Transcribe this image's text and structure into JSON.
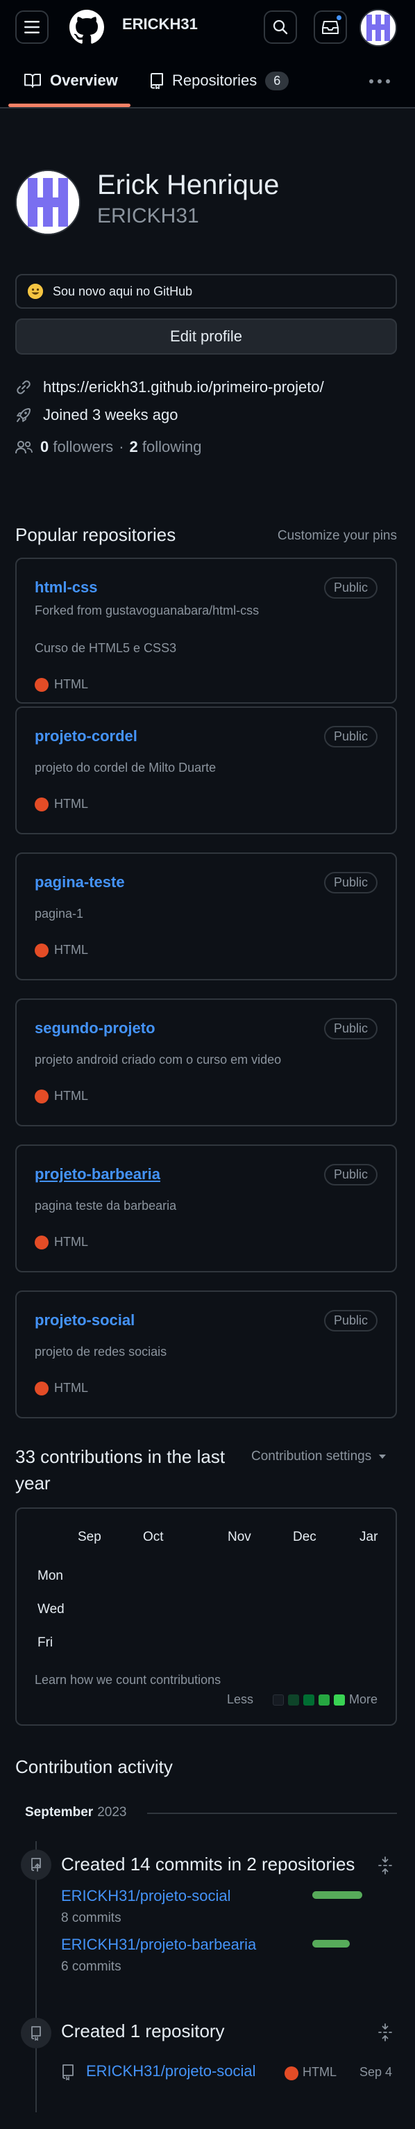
{
  "header": {
    "username": "ERICKH31",
    "icons": [
      "hamburger-menu-icon",
      "github-logo-icon",
      "search-icon",
      "inbox-icon",
      "avatar"
    ]
  },
  "tabs": [
    {
      "label": "Overview",
      "icon": "book-icon",
      "active": true
    },
    {
      "label": "Repositories",
      "icon": "repo-icon",
      "count": "6",
      "active": false
    }
  ],
  "profile": {
    "name": "Erick Henrique",
    "login": "ERICKH31",
    "status": "Sou novo aqui no GitHub",
    "edit_label": "Edit profile",
    "website": "https://erickh31.github.io/primeiro-projeto/",
    "joined": "Joined 3 weeks ago",
    "followers_count": "0",
    "followers_label": "followers",
    "separator": "·",
    "following_count": "2",
    "following_label": "following"
  },
  "popular": {
    "title": "Popular repositories",
    "customize_label": "Customize your pins",
    "repos": [
      {
        "name": "html-css",
        "visibility": "Public",
        "forked_from": "Forked from gustavoguanabara/html-css",
        "description": "Curso de HTML5 e CSS3",
        "language": "HTML"
      },
      {
        "name": "projeto-cordel",
        "visibility": "Public",
        "description": "projeto do cordel de Milto Duarte",
        "language": "HTML"
      },
      {
        "name": "pagina-teste",
        "visibility": "Public",
        "description": "pagina-1",
        "language": "HTML"
      },
      {
        "name": "segundo-projeto",
        "visibility": "Public",
        "description": "projeto android criado com o curso em video",
        "language": "HTML"
      },
      {
        "name": "projeto-barbearia",
        "visibility": "Public",
        "description": "pagina teste da barbearia",
        "language": "HTML"
      },
      {
        "name": "projeto-social",
        "visibility": "Public",
        "description": "projeto de redes sociais",
        "language": "HTML"
      }
    ]
  },
  "contributions": {
    "title": "33 contributions in the last year",
    "settings_label": "Contribution settings",
    "months": [
      "Sep",
      "Oct",
      "Nov",
      "Dec",
      "Jar"
    ],
    "weekdays": [
      "Mon",
      "Wed",
      "Fri"
    ],
    "learn_label": "Learn how we count contributions",
    "legend_less": "Less",
    "legend_more": "More",
    "legend_colors": [
      "#161b22",
      "#0e4429",
      "#006d32",
      "#26a641",
      "#39d353"
    ]
  },
  "activity": {
    "title": "Contribution activity",
    "month_label": "September",
    "year_label": "2023",
    "commits_heading": "Created 14 commits in 2 repositories",
    "commit_repos": [
      {
        "name": "ERICKH31/projeto-social",
        "commits": "8 commits",
        "share": 0.57
      },
      {
        "name": "ERICKH31/projeto-barbearia",
        "commits": "6 commits",
        "share": 0.43
      }
    ],
    "created_heading": "Created 1 repository",
    "created_repo": {
      "name": "ERICKH31/projeto-social",
      "language": "HTML",
      "date": "Sep 4"
    }
  },
  "colors": {
    "background": "#0d1117",
    "header": "#010409",
    "border": "#30363d",
    "link": "#4493f8",
    "tab_underline": "#f78166",
    "html_language": "#e34c26",
    "commit_bar": "#57ab5a"
  }
}
